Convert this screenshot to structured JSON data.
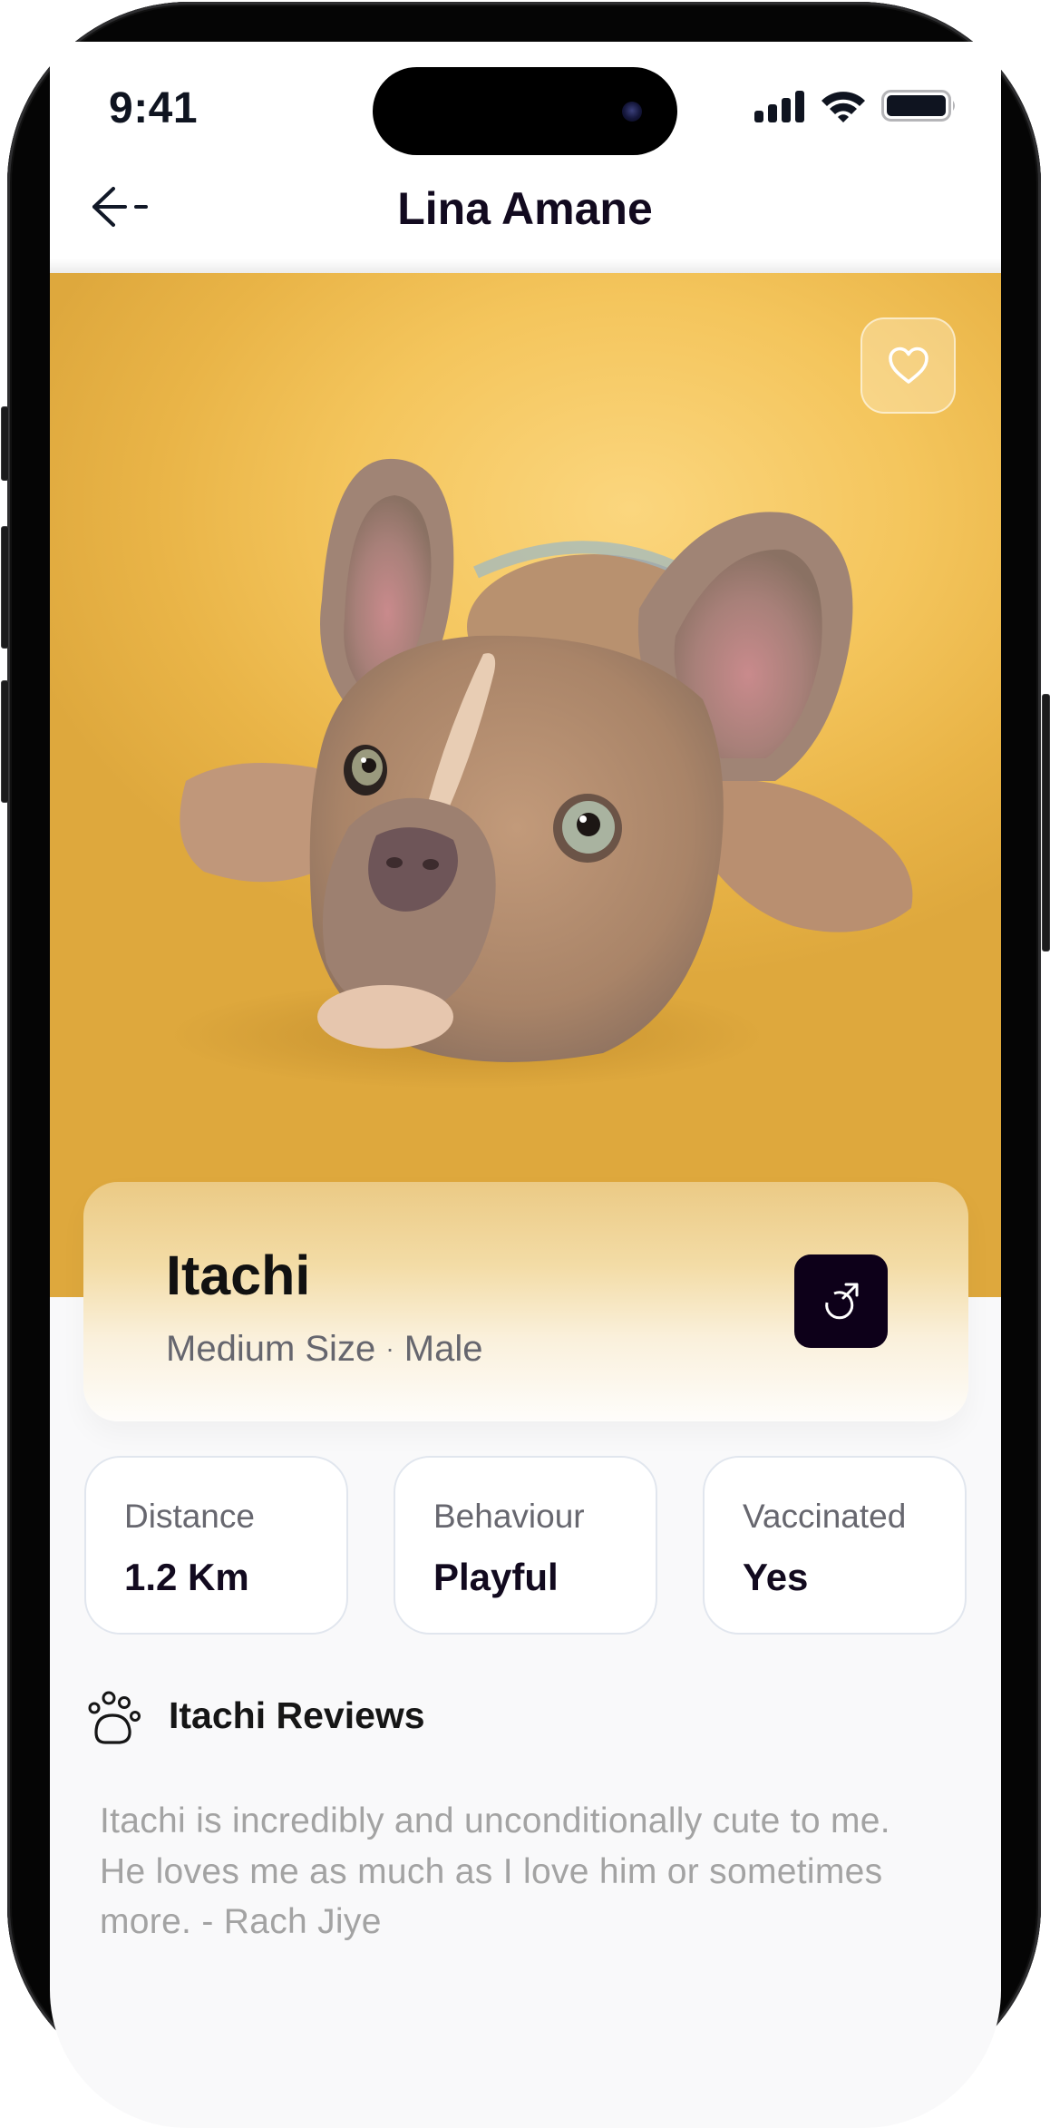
{
  "status_bar": {
    "time": "9:41",
    "icons": [
      "signal-icon",
      "wifi-icon",
      "battery-icon"
    ]
  },
  "header": {
    "back_icon": "arrow-left-icon",
    "title": "Lina Amane"
  },
  "photo": {
    "subject": "french-bulldog-puppy",
    "favorite_icon": "heart-outline-icon"
  },
  "pet": {
    "name": "Itachi",
    "size": "Medium Size",
    "separator": "·",
    "gender": "Male",
    "gender_icon": "male-symbol-icon"
  },
  "stats": [
    {
      "label": "Distance",
      "value": "1.2 Km"
    },
    {
      "label": "Behaviour",
      "value": "Playful"
    },
    {
      "label": "Vaccinated",
      "value": "Yes"
    }
  ],
  "reviews": {
    "icon": "paw-icon",
    "title": "Itachi Reviews",
    "text": "Itachi is incredibly and unconditionally cute to me. He loves me as much as I love him or sometimes more. - Rach Jiye"
  },
  "colors": {
    "primary_dark": "#0d0019",
    "photo_background": "#f4c55c",
    "text_dark": "#120a1f",
    "text_muted": "#67676f",
    "review_text": "#a3a3a3"
  }
}
